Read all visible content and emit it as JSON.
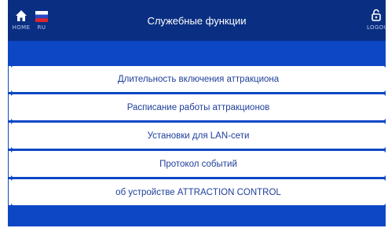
{
  "header": {
    "home_label": "HOME",
    "lang_label": "RU",
    "title": "Служебные функции",
    "logout_label": "LOGOU"
  },
  "menu": {
    "items": [
      {
        "label": "Длительность включения аттракциона"
      },
      {
        "label": "Расписание работы аттракционов"
      },
      {
        "label": "Установки для LAN-сети"
      },
      {
        "label": "Протокол событий"
      },
      {
        "label": "об устройстве ATTRACTION CONTROL"
      }
    ]
  },
  "colors": {
    "background": "#0d47c6",
    "header": "#0a2f82",
    "button_bg": "#ffffff",
    "button_text": "#1f3f9a"
  },
  "icons": [
    "home-icon",
    "russia-flag-icon",
    "logout-lock-icon"
  ]
}
